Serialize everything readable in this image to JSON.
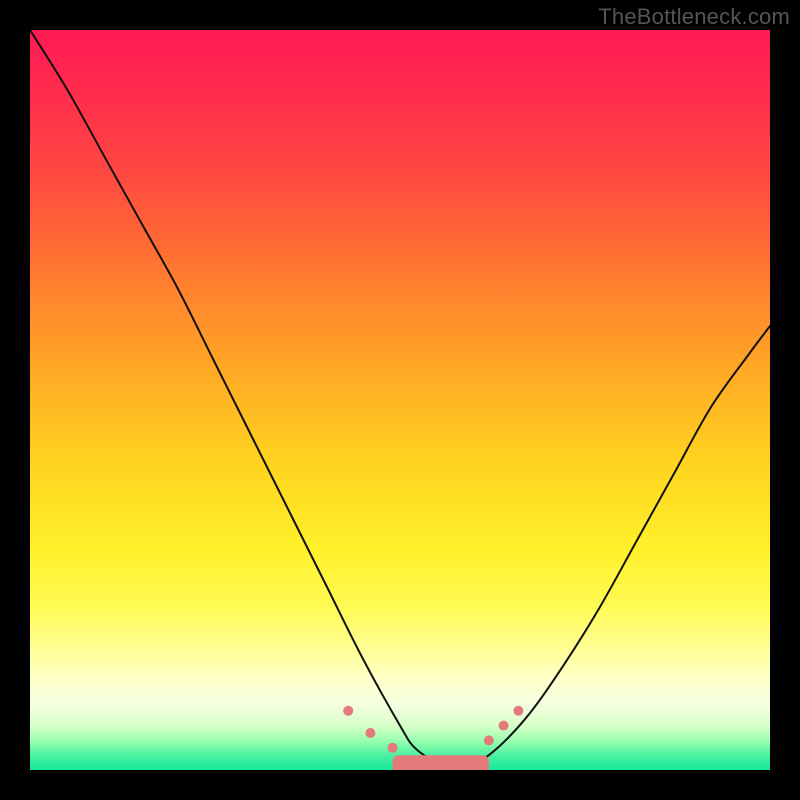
{
  "watermark": "TheBottleneck.com",
  "chart_data": {
    "type": "line",
    "title": "",
    "xlabel": "",
    "ylabel": "",
    "xlim": [
      0,
      100
    ],
    "ylim": [
      0,
      100
    ],
    "grid": false,
    "legend": false,
    "annotations": [],
    "background_gradient": {
      "direction": "vertical",
      "stops": [
        {
          "pos": 0,
          "color": "#ff1a55"
        },
        {
          "pos": 20,
          "color": "#ff4a40"
        },
        {
          "pos": 45,
          "color": "#ffa526"
        },
        {
          "pos": 70,
          "color": "#fff02a"
        },
        {
          "pos": 88,
          "color": "#ffffcc"
        },
        {
          "pos": 100,
          "color": "#18e89a"
        }
      ]
    },
    "series": [
      {
        "name": "left-curve",
        "x": [
          0,
          5,
          10,
          15,
          20,
          25,
          30,
          35,
          40,
          45,
          50,
          52,
          55,
          58
        ],
        "y": [
          100,
          92,
          83,
          74,
          65,
          55,
          45,
          35,
          25,
          15,
          6,
          3,
          1,
          0
        ]
      },
      {
        "name": "right-curve",
        "x": [
          58,
          62,
          67,
          72,
          77,
          82,
          87,
          92,
          97,
          100
        ],
        "y": [
          0,
          2,
          7,
          14,
          22,
          31,
          40,
          49,
          56,
          60
        ]
      }
    ],
    "markers": [
      {
        "x": 43,
        "y": 8,
        "r": 5
      },
      {
        "x": 46,
        "y": 5,
        "r": 5
      },
      {
        "x": 49,
        "y": 3,
        "r": 5
      },
      {
        "x": 62,
        "y": 4,
        "r": 5
      },
      {
        "x": 64,
        "y": 6,
        "r": 5
      },
      {
        "x": 66,
        "y": 8,
        "r": 5
      }
    ],
    "marker_bar": {
      "x0": 49,
      "x1": 62,
      "y": 0.5,
      "h": 3
    }
  }
}
